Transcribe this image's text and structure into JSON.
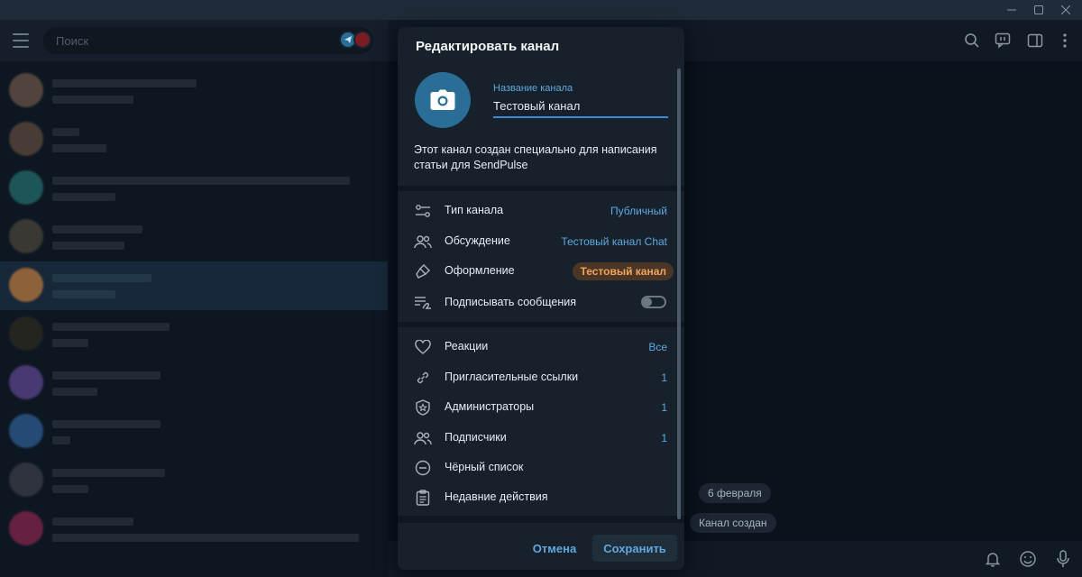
{
  "window": {
    "controls": [
      "minimize",
      "maximize",
      "close"
    ]
  },
  "sidebar": {
    "search_placeholder": "Поиск"
  },
  "chat": {
    "service_date": "6 февраля",
    "service_created": "Канал создан"
  },
  "dialog": {
    "title": "Редактировать канал",
    "name_label": "Название канала",
    "name_value": "Тестовый канал",
    "description": "Этот канал создан специально для написания статьи для SendPulse",
    "section1": [
      {
        "icon": "sliders-icon",
        "label": "Тип канала",
        "value": "Публичный"
      },
      {
        "icon": "users-icon",
        "label": "Обсуждение",
        "value": "Тестовый канал Chat"
      },
      {
        "icon": "brush-icon",
        "label": "Оформление",
        "value": "Тестовый канал"
      },
      {
        "icon": "signature-icon",
        "label": "Подписывать сообщения",
        "toggle": false
      }
    ],
    "section2": [
      {
        "icon": "heart-icon",
        "label": "Реакции",
        "value": "Все"
      },
      {
        "icon": "link-icon",
        "label": "Пригласительные ссылки",
        "value": "1"
      },
      {
        "icon": "shield-star-icon",
        "label": "Администраторы",
        "value": "1"
      },
      {
        "icon": "users-icon",
        "label": "Подписчики",
        "value": "1"
      },
      {
        "icon": "minus-circle-icon",
        "label": "Чёрный список",
        "value": ""
      },
      {
        "icon": "clipboard-icon",
        "label": "Недавние действия",
        "value": ""
      }
    ],
    "cancel_label": "Отмена",
    "save_label": "Сохранить"
  },
  "colors": {
    "accent": "#5fa8e0",
    "avatar": "#2a6e98",
    "badge_text": "#f0a55a",
    "badge_bg": "#4a3527"
  }
}
